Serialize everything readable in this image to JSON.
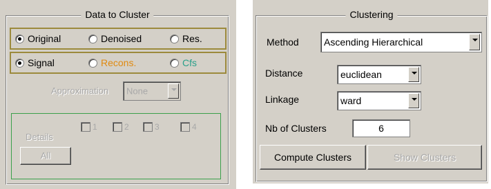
{
  "left": {
    "title": "Data to Cluster",
    "radio_row1": [
      {
        "label": "Original",
        "checked": true
      },
      {
        "label": "Denoised",
        "checked": false
      },
      {
        "label": "Res.",
        "checked": false
      }
    ],
    "radio_row2": [
      {
        "label": "Signal",
        "checked": true,
        "color": "#000000"
      },
      {
        "label": "Recons.",
        "checked": false,
        "color": "#e08a10"
      },
      {
        "label": "Cfs",
        "checked": false,
        "color": "#2aa08a"
      }
    ],
    "approximation_label": "Approximation",
    "approximation_value": "None",
    "details_label": "Details",
    "detail_checks": [
      "1",
      "2",
      "3",
      "4"
    ],
    "all_button": "All"
  },
  "right": {
    "title": "Clustering",
    "method_label": "Method",
    "method_value": "Ascending Hierarchical",
    "distance_label": "Distance",
    "distance_value": "euclidean",
    "linkage_label": "Linkage",
    "linkage_value": "ward",
    "nb_label": "Nb of Clusters",
    "nb_value": "6",
    "compute_button": "Compute Clusters",
    "show_button": "Show Clusters"
  }
}
